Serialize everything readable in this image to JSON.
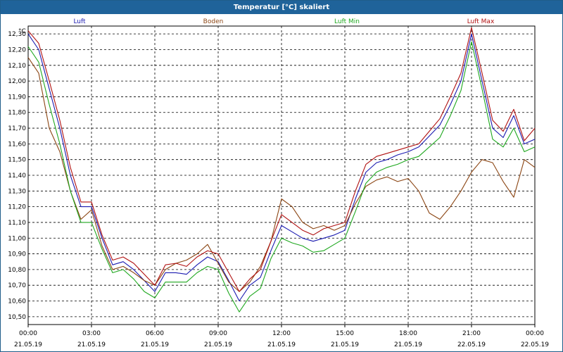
{
  "window": {
    "title": "Temperatur [°C] skaliert"
  },
  "chart_data": {
    "type": "line",
    "unit": "°C",
    "ylim": [
      10.45,
      12.35
    ],
    "yticks": [
      "10,50",
      "10,60",
      "10,70",
      "10,80",
      "10,90",
      "11,00",
      "11,10",
      "11,20",
      "11,30",
      "11,40",
      "11,50",
      "11,60",
      "11,70",
      "11,80",
      "11,90",
      "12,00",
      "12,10",
      "12,20",
      "12,30"
    ],
    "ytick_values": [
      10.5,
      10.6,
      10.7,
      10.8,
      10.9,
      11.0,
      11.1,
      11.2,
      11.3,
      11.4,
      11.5,
      11.6,
      11.7,
      11.8,
      11.9,
      12.0,
      12.1,
      12.2,
      12.3
    ],
    "xlim_hours": [
      0,
      24
    ],
    "xticks": [
      {
        "time": "00:00",
        "date": "21.05.19"
      },
      {
        "time": "03:00",
        "date": "21.05.19"
      },
      {
        "time": "06:00",
        "date": "21.05.19"
      },
      {
        "time": "09:00",
        "date": "21.05.19"
      },
      {
        "time": "12:00",
        "date": "21.05.19"
      },
      {
        "time": "15:00",
        "date": "21.05.19"
      },
      {
        "time": "18:00",
        "date": "21.05.19"
      },
      {
        "time": "21:00",
        "date": "22.05.19"
      },
      {
        "time": "00:00",
        "date": "22.05.19"
      }
    ],
    "grid": true,
    "legend_position": "top",
    "series": [
      {
        "name": "Luft",
        "color": "#1a1ab0",
        "x": [
          0,
          0.5,
          1,
          1.5,
          2,
          2.5,
          3,
          3.5,
          4,
          4.5,
          5,
          5.5,
          6,
          6.5,
          7,
          7.5,
          8,
          8.5,
          9,
          9.5,
          10,
          10.5,
          11,
          11.5,
          12,
          12.5,
          13,
          13.5,
          14,
          14.5,
          15,
          15.5,
          16,
          16.5,
          17,
          17.5,
          18,
          18.5,
          19,
          19.5,
          20,
          20.5,
          21,
          21.5,
          22,
          22.5,
          23,
          23.5,
          24
        ],
        "values": [
          12.3,
          12.2,
          11.95,
          11.7,
          11.4,
          11.2,
          11.2,
          11.0,
          10.83,
          10.85,
          10.8,
          10.73,
          10.66,
          10.78,
          10.78,
          10.77,
          10.83,
          10.88,
          10.85,
          10.73,
          10.6,
          10.7,
          10.75,
          10.92,
          11.08,
          11.04,
          11.0,
          10.98,
          11.0,
          11.02,
          11.05,
          11.25,
          11.42,
          11.48,
          11.5,
          11.53,
          11.55,
          11.58,
          11.65,
          11.72,
          11.85,
          12.0,
          12.3,
          12.0,
          11.7,
          11.64,
          11.78,
          11.6,
          11.63
        ]
      },
      {
        "name": "Boden",
        "color": "#8b4513",
        "x": [
          0,
          0.5,
          1,
          1.5,
          2,
          2.5,
          3,
          3.5,
          4,
          4.5,
          5,
          5.5,
          6,
          6.5,
          7,
          7.5,
          8,
          8.5,
          9,
          9.5,
          10,
          10.5,
          11,
          11.5,
          12,
          12.5,
          13,
          13.5,
          14,
          14.5,
          15,
          15.5,
          16,
          16.5,
          17,
          17.5,
          18,
          18.5,
          19,
          19.5,
          20,
          20.5,
          21,
          21.5,
          22,
          22.5,
          23,
          23.5,
          24
        ],
        "values": [
          12.15,
          12.05,
          11.7,
          11.55,
          11.3,
          11.12,
          11.18,
          10.95,
          10.8,
          10.82,
          10.78,
          10.73,
          10.7,
          10.8,
          10.84,
          10.86,
          10.9,
          10.96,
          10.84,
          10.72,
          10.66,
          10.72,
          10.82,
          10.98,
          11.25,
          11.2,
          11.1,
          11.06,
          11.08,
          11.05,
          11.08,
          11.22,
          11.33,
          11.37,
          11.39,
          11.36,
          11.38,
          11.3,
          11.16,
          11.12,
          11.2,
          11.3,
          11.42,
          11.5,
          11.48,
          11.36,
          11.26,
          11.5,
          11.45
        ]
      },
      {
        "name": "Luft Min",
        "color": "#1fa81f",
        "x": [
          0,
          0.5,
          1,
          1.5,
          2,
          2.5,
          3,
          3.5,
          4,
          4.5,
          5,
          5.5,
          6,
          6.5,
          7,
          7.5,
          8,
          8.5,
          9,
          9.5,
          10,
          10.5,
          11,
          11.5,
          12,
          12.5,
          13,
          13.5,
          14,
          14.5,
          15,
          15.5,
          16,
          16.5,
          17,
          17.5,
          18,
          18.5,
          19,
          19.5,
          20,
          20.5,
          21,
          21.5,
          22,
          22.5,
          23,
          23.5,
          24
        ],
        "values": [
          12.22,
          12.12,
          11.85,
          11.6,
          11.3,
          11.1,
          11.1,
          10.93,
          10.78,
          10.8,
          10.74,
          10.66,
          10.62,
          10.72,
          10.72,
          10.72,
          10.78,
          10.82,
          10.8,
          10.65,
          10.53,
          10.63,
          10.68,
          10.87,
          11.0,
          10.97,
          10.95,
          10.91,
          10.92,
          10.96,
          11.0,
          11.17,
          11.35,
          11.42,
          11.45,
          11.47,
          11.5,
          11.52,
          11.58,
          11.64,
          11.78,
          11.94,
          12.25,
          11.95,
          11.63,
          11.58,
          11.7,
          11.55,
          11.58
        ]
      },
      {
        "name": "Luft Max",
        "color": "#b01010",
        "x": [
          0,
          0.5,
          1,
          1.5,
          2,
          2.5,
          3,
          3.5,
          4,
          4.5,
          5,
          5.5,
          6,
          6.5,
          7,
          7.5,
          8,
          8.5,
          9,
          9.5,
          10,
          10.5,
          11,
          11.5,
          12,
          12.5,
          13,
          13.5,
          14,
          14.5,
          15,
          15.5,
          16,
          16.5,
          17,
          17.5,
          18,
          18.5,
          19,
          19.5,
          20,
          20.5,
          21,
          21.5,
          22,
          22.5,
          23,
          23.5,
          24
        ],
        "values": [
          12.32,
          12.24,
          12.0,
          11.75,
          11.45,
          11.23,
          11.23,
          11.02,
          10.86,
          10.88,
          10.84,
          10.77,
          10.7,
          10.83,
          10.84,
          10.82,
          10.88,
          10.92,
          10.9,
          10.78,
          10.66,
          10.74,
          10.8,
          10.98,
          11.15,
          11.1,
          11.05,
          11.02,
          11.06,
          11.08,
          11.1,
          11.3,
          11.47,
          11.52,
          11.54,
          11.56,
          11.58,
          11.6,
          11.68,
          11.76,
          11.9,
          12.05,
          12.34,
          12.05,
          11.75,
          11.68,
          11.82,
          11.62,
          11.7
        ]
      }
    ]
  }
}
